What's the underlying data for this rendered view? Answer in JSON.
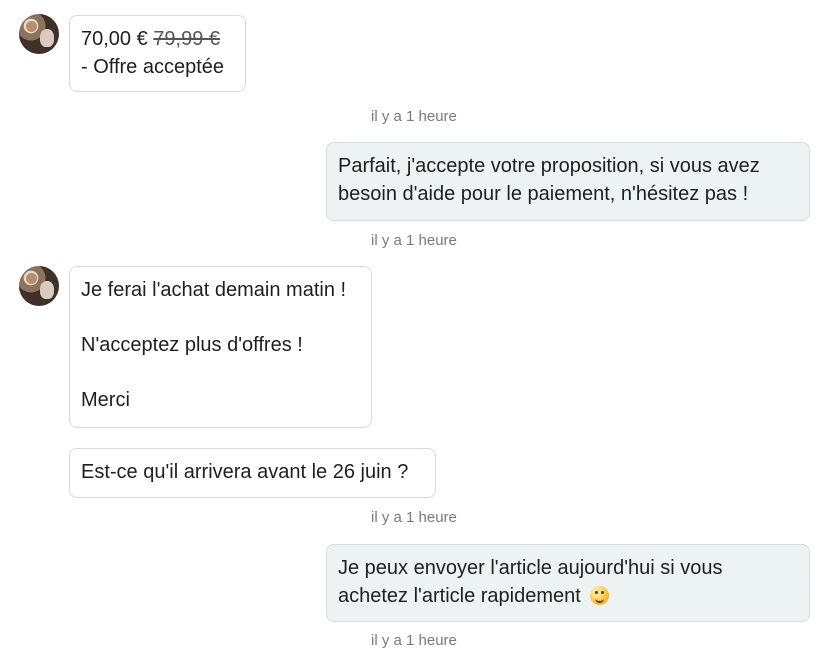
{
  "messages": [
    {
      "offer": {
        "price": "70,00 €",
        "original_price": "79,99 €",
        "status": "- Offre acceptée"
      }
    },
    {
      "timestamp": "il y a 1 heure"
    },
    {
      "text_lines": [
        "Parfait, j'accepte votre proposition, si vous avez",
        "besoin d'aide pour le paiement, n'hésitez pas !"
      ]
    },
    {
      "timestamp": "il y a 1 heure"
    },
    {
      "text_lines": [
        "Je ferai l'achat demain matin !",
        "N'acceptez plus d'offres !",
        "Merci"
      ]
    },
    {
      "text": "Est-ce qu'il arrivera avant le 26 juin ?"
    },
    {
      "timestamp": "il y a 1 heure"
    },
    {
      "text_lines": [
        "Je peux envoyer l'article aujourd'hui si vous",
        "achetez l'article rapidement"
      ],
      "emoji": "grinning-face-icon"
    },
    {
      "timestamp": "il y a 1 heure"
    }
  ]
}
